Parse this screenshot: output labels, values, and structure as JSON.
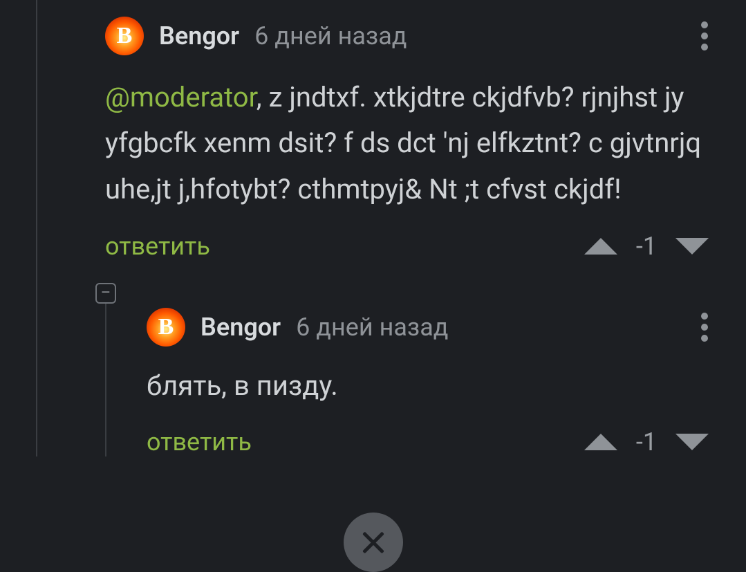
{
  "avatar_letter": "B",
  "reply_label": "ответить",
  "collapse_glyph": "–",
  "comments": [
    {
      "username": "Bengor",
      "timestamp": "6 дней назад",
      "mention": "@moderator",
      "body_rest": ", z jndtxf. xtkjdtre ckjdfvb? rjnjhst jy yfgbcfk xenm dsit? f ds dct 'nj elfkztnt? c gjvtnrjq uhe,jt j,hfotybt? cthmtpyj& Nt ;t cfvst ckjdf!",
      "score": "-1"
    },
    {
      "username": "Bengor",
      "timestamp": "6 дней назад",
      "body": "блять, в пизду.",
      "score": "-1"
    }
  ]
}
